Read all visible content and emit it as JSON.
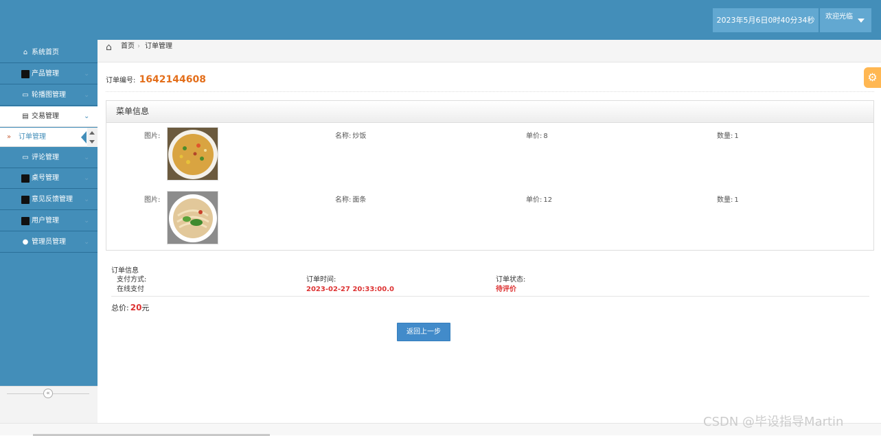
{
  "header": {
    "datetime": "2023年5月6日0时40分34秒",
    "welcome": "欢迎光临"
  },
  "sidebar": {
    "items": [
      {
        "label": "系统首页",
        "icon": "home-icon"
      },
      {
        "label": "产品管理",
        "icon": "box-icon"
      },
      {
        "label": "轮播图管理",
        "icon": "chat-icon"
      },
      {
        "label": "交易管理",
        "icon": "document-icon"
      },
      {
        "label": "评论管理",
        "icon": "chat-icon"
      },
      {
        "label": "桌号管理",
        "icon": "box-icon"
      },
      {
        "label": "意见反馈管理",
        "icon": "box-icon"
      },
      {
        "label": "用户管理",
        "icon": "box-icon"
      },
      {
        "label": "管理员管理",
        "icon": "user-icon"
      }
    ],
    "sub_item": "订单管理",
    "collapse_symbol": "«"
  },
  "breadcrumb": {
    "home": "首页",
    "current": "订单管理"
  },
  "order": {
    "number_label": "订单编号:",
    "number": "1642144608"
  },
  "menu_panel": {
    "title": "菜单信息",
    "image_label": "图片:",
    "name_label": "名称:",
    "price_label": "单价:",
    "qty_label": "数量:",
    "rows": [
      {
        "name": "炒饭",
        "price": "8",
        "qty": "1"
      },
      {
        "name": "面条",
        "price": "12",
        "qty": "1"
      }
    ]
  },
  "order_info": {
    "title": "订单信息",
    "payment_label": "支付方式:",
    "payment_value": "在线支付",
    "time_label": "订单时间:",
    "time_value": "2023-02-27 20:33:00.0",
    "status_label": "订单状态:",
    "status_value": "待评价"
  },
  "total": {
    "label": "总价:",
    "amount": "20",
    "unit": "元"
  },
  "back_button": "返回上一步",
  "watermark": "CSDN @毕设指导Martin",
  "colors": {
    "primary": "#438eb9",
    "accent_orange": "#e36e1a",
    "alert_red": "#dd3333",
    "button_blue": "#428bca"
  }
}
